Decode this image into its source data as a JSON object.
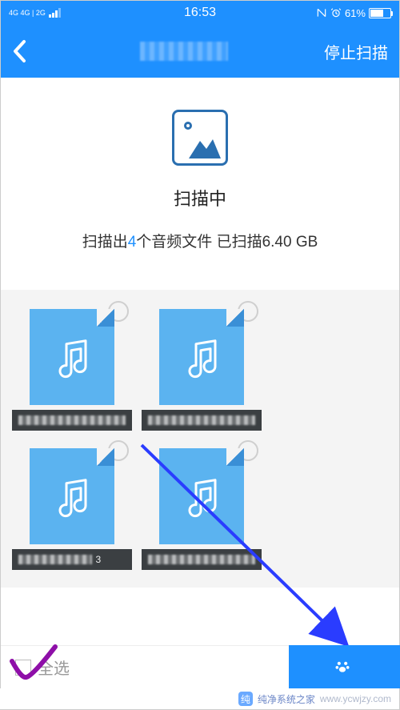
{
  "status": {
    "signal_text": "4G 4G | 2G",
    "time": "16:53",
    "battery_pct": "61%"
  },
  "header": {
    "stop_label": "停止扫描"
  },
  "scan": {
    "status_text": "扫描中",
    "detail_prefix": "扫描出",
    "count": "4",
    "detail_mid": "个音频文件 已扫描",
    "size": "6.40 GB"
  },
  "files": [
    {
      "blurred": true
    },
    {
      "blurred": true
    },
    {
      "blurred": true,
      "label_suffix": "3"
    },
    {
      "blurred": true
    }
  ],
  "bottom": {
    "select_all_label": "全选",
    "action_label": " "
  },
  "watermark": {
    "brand": "纯净系统之家",
    "url": "www.ycwjzy.com"
  }
}
